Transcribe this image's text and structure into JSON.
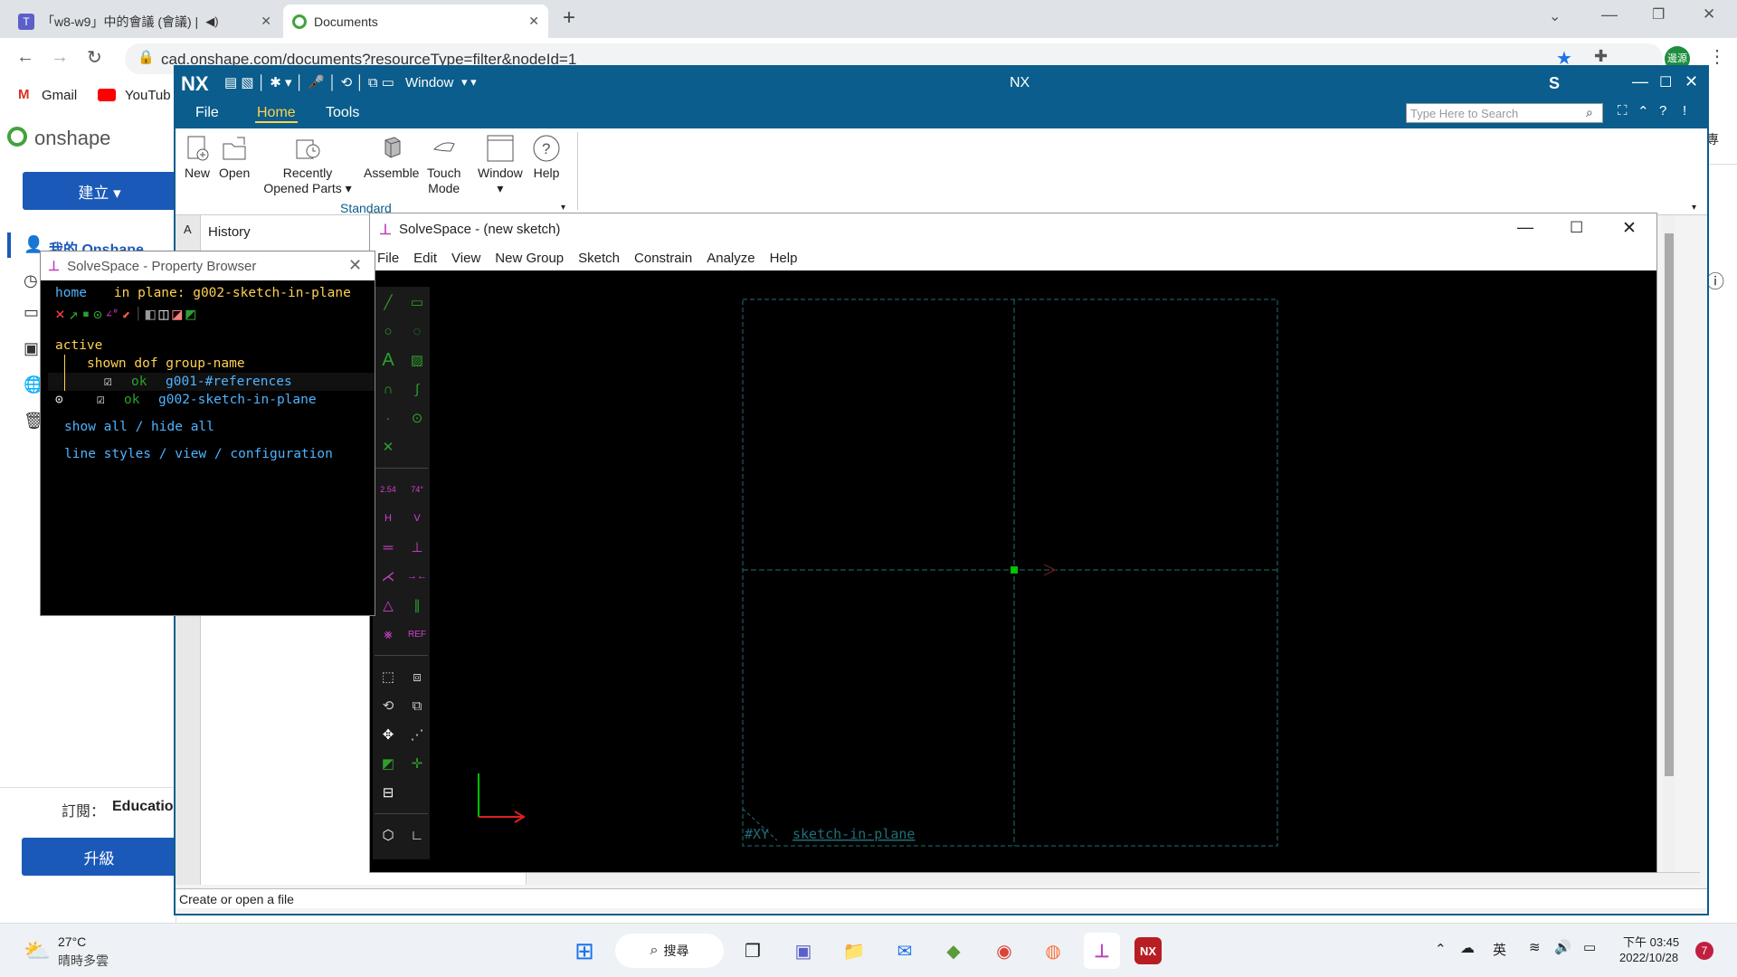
{
  "browser": {
    "tabs": [
      {
        "label": "「w8-w9」中的會議 (會議) |",
        "active": false
      },
      {
        "label": "Documents",
        "active": true
      }
    ],
    "new_tab": "+",
    "url": "cad.onshape.com/documents?resourceType=filter&nodeId=1",
    "bookmarks": [
      "Gmail",
      "YouTub"
    ],
    "profile_badge": "邊源"
  },
  "onshape": {
    "logo": "onshape",
    "create_button": "建立 ▾",
    "my_onshape": "我的 Onshape",
    "subscription_label": "訂閱：",
    "subscription_value": "Educatio",
    "upgrade_button": "升級",
    "cut_char": "專"
  },
  "nx": {
    "logo": "NX",
    "title": "NX",
    "window_menu": "Window",
    "user_badge": "S",
    "menu": [
      "File",
      "Home",
      "Tools"
    ],
    "active_menu": "Home",
    "search_placeholder": "Type Here to Search",
    "ribbon": [
      {
        "label": "New",
        "icon": "new-file-icon"
      },
      {
        "label": "Open",
        "icon": "open-folder-icon"
      },
      {
        "label": "Recently\nOpened Parts ▾",
        "icon": "recent-parts-icon"
      },
      {
        "label": "Assemble",
        "icon": "assemble-icon"
      },
      {
        "label": "Touch\nMode",
        "icon": "touch-mode-icon"
      },
      {
        "label": "Window\n▾",
        "icon": "window-icon"
      },
      {
        "label": "Help",
        "icon": "help-icon"
      }
    ],
    "group_label": "Standard",
    "history_tab_letter": "A",
    "history_label": "History",
    "status_text": "Create or open a file"
  },
  "solvespace": {
    "title": "SolveSpace - (new sketch)",
    "menu": [
      "File",
      "Edit",
      "View",
      "New Group",
      "Sketch",
      "Constrain",
      "Analyze",
      "Help"
    ],
    "canvas_labels": {
      "plane": "#XY",
      "sketch": "sketch-in-plane"
    },
    "colors": {
      "bg": "#000000",
      "grid": "#1f6f78",
      "origin": "#00c000",
      "axis_x": "#e02020",
      "axis_y": "#00c000",
      "magenta": "#d040d0"
    },
    "tool_labels": {
      "dim": "2.54",
      "angle": "74°",
      "ref": "REF"
    }
  },
  "property_browser": {
    "title": "SolveSpace - Property Browser",
    "home": "home",
    "in_plane": "in plane: g002-sketch-in-plane",
    "active_label": "active",
    "header": "shown dof group-name",
    "groups": [
      {
        "dof": "ok",
        "name": "g001-#references",
        "active": false
      },
      {
        "dof": "ok",
        "name": "g002-sketch-in-plane",
        "active": true
      }
    ],
    "show_all": "show all",
    "hide_all": "hide all",
    "slash": "/",
    "line_styles": "line styles",
    "view": "view",
    "configuration": "configuration"
  },
  "taskbar": {
    "weather_temp": "27°C",
    "weather_desc": "晴時多雲",
    "search_label": "搜尋",
    "ime": "英",
    "time": "下午 03:45",
    "date": "2022/10/28",
    "notif_count": "7"
  }
}
